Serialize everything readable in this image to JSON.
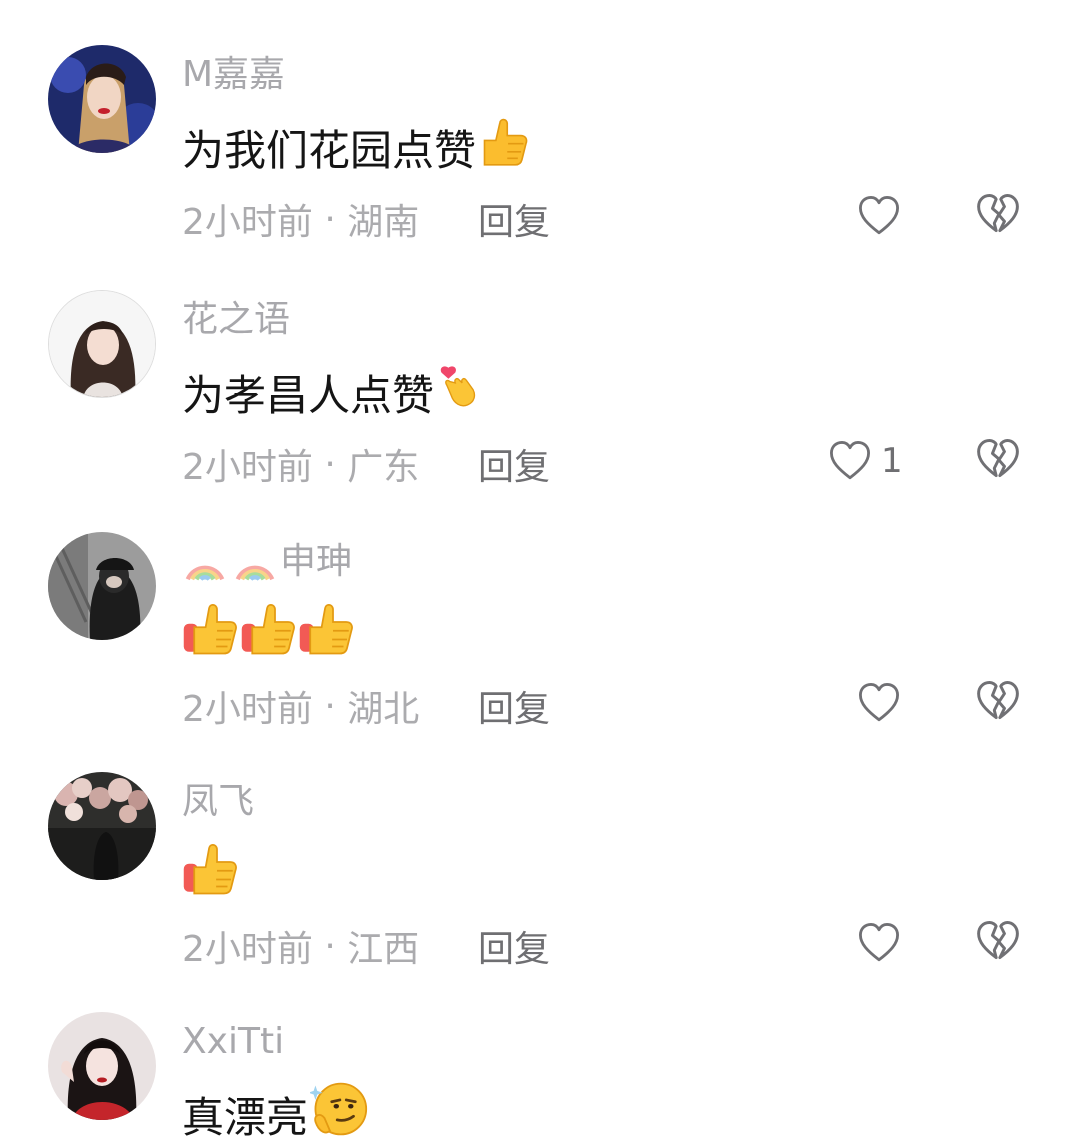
{
  "comments": [
    {
      "username": "M嘉嘉",
      "text": "为我们花园点赞",
      "emojis": [
        "thumbs-up"
      ],
      "time": "2小时前",
      "location": "湖南",
      "likes": ""
    },
    {
      "username": "花之语",
      "text": "为孝昌人点赞",
      "emojis": [
        "finger-heart"
      ],
      "time": "2小时前",
      "location": "广东",
      "likes": "1"
    },
    {
      "username": "申珅",
      "username_emojis": [
        "rainbow",
        "rainbow"
      ],
      "text": "",
      "emojis": [
        "thumbs-up",
        "thumbs-up",
        "thumbs-up"
      ],
      "time": "2小时前",
      "location": "湖北",
      "likes": ""
    },
    {
      "username": "凤飞",
      "text": "",
      "emojis": [
        "thumbs-up"
      ],
      "time": "2小时前",
      "location": "江西",
      "likes": ""
    },
    {
      "username": "XxiTti",
      "text": "真漂亮",
      "emojis": [
        "smirk-thinking"
      ],
      "time": "",
      "location": "",
      "likes": ""
    }
  ],
  "reply_label": "回复",
  "separator": " · ",
  "colors": {
    "username": "#a8a8ac",
    "text": "#151515",
    "meta": "#ababae",
    "reply": "#6f6f72",
    "icon": "#707074"
  }
}
